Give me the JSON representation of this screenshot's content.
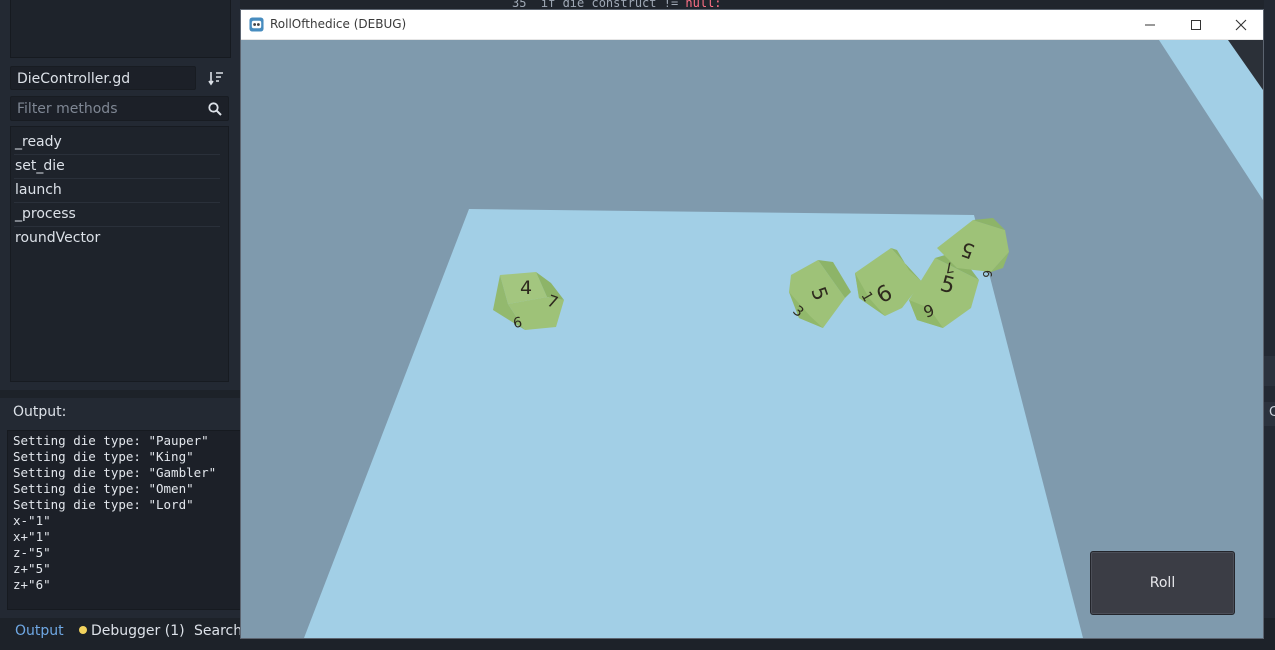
{
  "editor": {
    "script_name": "DieController.gd",
    "filter_placeholder": "Filter methods",
    "methods": [
      "_ready",
      "set_die",
      "launch",
      "_process",
      "roundVector"
    ],
    "output_title": "Output:",
    "output_lines": [
      "Setting die type: \"Pauper\"",
      "Setting die type: \"King\"",
      "Setting die type: \"Gambler\"",
      "Setting die type: \"Omen\"",
      "Setting die type: \"Lord\"",
      "x-\"1\"",
      "x+\"1\"",
      "z-\"5\"",
      "z+\"5\"",
      "z+\"6\""
    ],
    "bottom_tabs": {
      "output": "Output",
      "debugger": "Debugger (1)",
      "search": "Search"
    },
    "code_snippet": {
      "line_no": "35",
      "text": "if die_construct != ",
      "keyword": "null:"
    },
    "right_label": "C"
  },
  "game_window": {
    "title": "RollOfthedice (DEBUG)",
    "roll_label": "Roll"
  },
  "dice": [
    {
      "top": "4",
      "right": "7",
      "front": "6"
    },
    {
      "top": "5",
      "right": "",
      "front": "3"
    },
    {
      "top": "9",
      "right": "",
      "front": "1"
    },
    {
      "top": "5",
      "right": "",
      "front": "9"
    },
    {
      "top": "5",
      "right": "6",
      "front": "7"
    }
  ],
  "colors": {
    "sky": "#7f9aad",
    "table": "#a2cfe6",
    "die": "#9ec278",
    "accent": "#6fa8e4",
    "debugger_dot": "#f2d35e"
  }
}
